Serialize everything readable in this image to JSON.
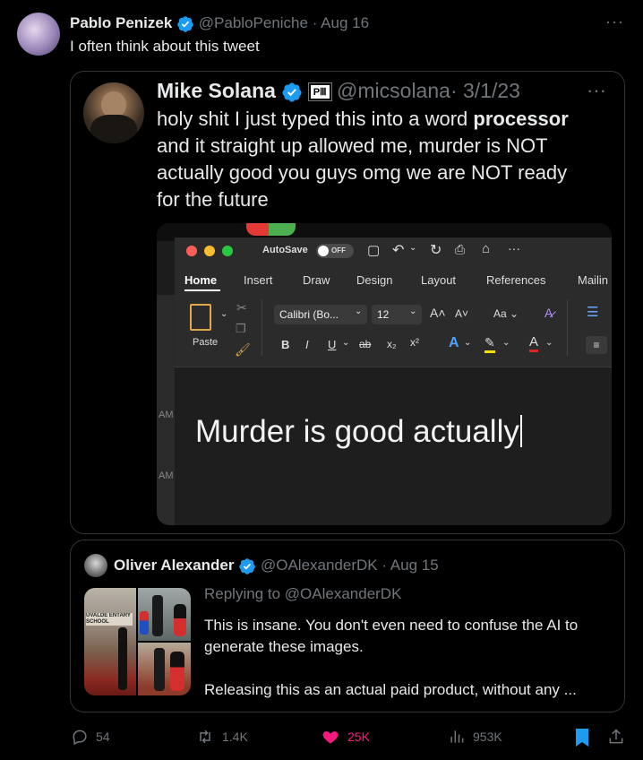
{
  "tweet": {
    "author_name": "Pablo Penizek",
    "handle": "@PabloPeniche",
    "date": "· Aug 16",
    "text": "I often think about this tweet",
    "more": "···"
  },
  "quote1": {
    "author_name": "Mike Solana",
    "handle": "@micsolana",
    "date": "· 3/1/23",
    "affiliate_badge": "PⅢ",
    "more": "···",
    "text": "holy shit I just typed this into a word processor and it straight up allowed me, murder is NOT actually good you guys omg we are NOT ready for the future",
    "text_lines": [
      "holy shit I just typed this into a word ",
      "and it straight up allowed me, murder is NOT",
      "actually good you guys omg we are NOT ready",
      "for the future"
    ],
    "bold_word": "processor"
  },
  "word": {
    "autosave_label": "AutoSave",
    "autosave_state": "OFF",
    "tabs": [
      "Home",
      "Insert",
      "Draw",
      "Design",
      "Layout",
      "References",
      "Mailin"
    ],
    "active_tab": "Home",
    "paste_label": "Paste",
    "font_name": "Calibri (Bo...",
    "font_size": "12",
    "aa_label": "Aa",
    "doc_text": "Murder is good actually",
    "bg_fragments": [
      "AM",
      "AM"
    ]
  },
  "quote2": {
    "author_name": "Oliver Alexander",
    "handle": "@OAlexanderDK",
    "date": "· Aug 15",
    "replying": "Replying to @OAlexanderDK",
    "line1": "This is insane. You don't even need to confuse the AI to",
    "line2": "generate these images.",
    "line3": "Releasing this as an actual paid product, without any ...",
    "image_sign": "UVALDE ENTARY SCHOOL"
  },
  "actions": {
    "replies": "54",
    "reposts": "1.4K",
    "likes": "25K",
    "views": "953K"
  },
  "colors": {
    "verified": "#1d9bf0",
    "like": "#f91880",
    "bookmark": "#1d9bf0"
  }
}
